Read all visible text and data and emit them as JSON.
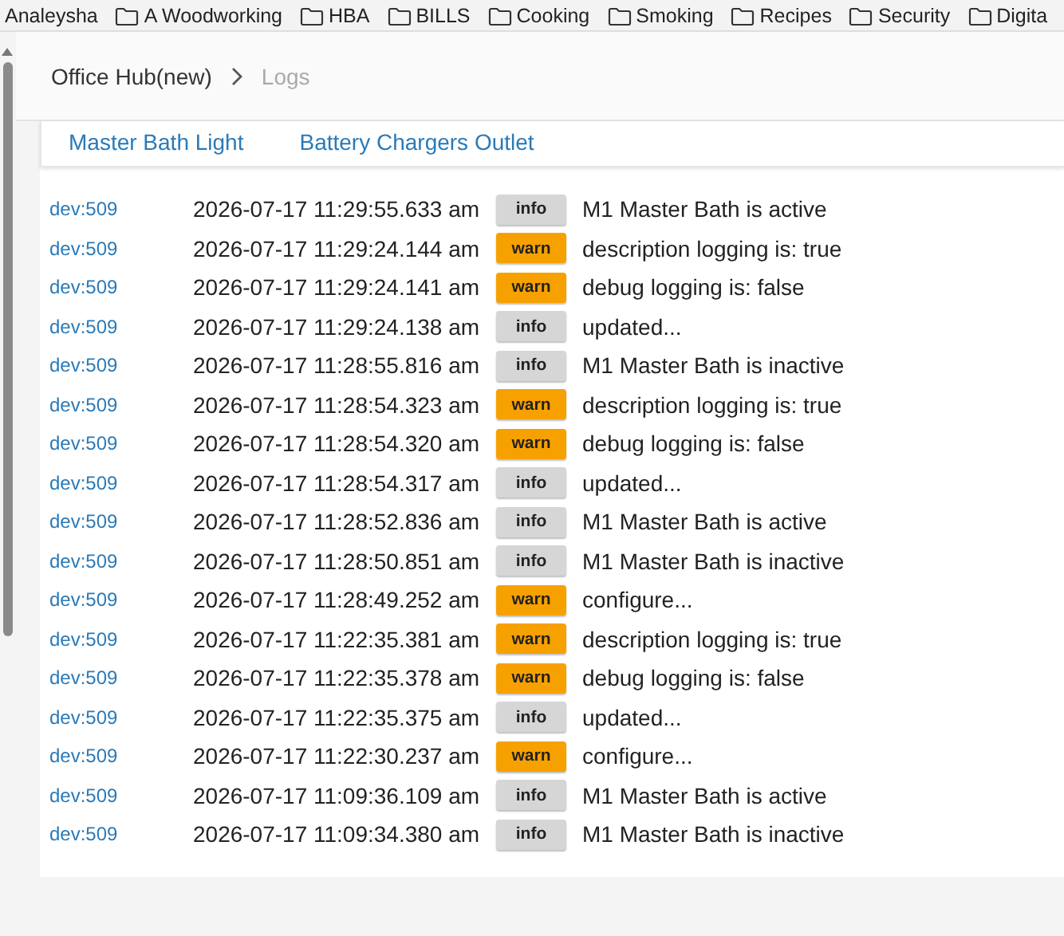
{
  "bookmarks": [
    {
      "label": "Analeysha",
      "kind": "link"
    },
    {
      "label": "A Woodworking",
      "kind": "folder"
    },
    {
      "label": "HBA",
      "kind": "folder"
    },
    {
      "label": "BILLS",
      "kind": "folder"
    },
    {
      "label": "Cooking",
      "kind": "folder"
    },
    {
      "label": "Smoking",
      "kind": "folder"
    },
    {
      "label": "Recipes",
      "kind": "folder"
    },
    {
      "label": "Security",
      "kind": "folder"
    },
    {
      "label": "Digita",
      "kind": "folder"
    }
  ],
  "breadcrumb": {
    "parent": "Office Hub(new)",
    "current": "Logs"
  },
  "device_links": [
    "Master Bath Light",
    "Battery Chargers Outlet"
  ],
  "logs": [
    {
      "device": "dev:509",
      "time": "2026-07-17 11:29:55.633 am",
      "severity": "info",
      "message": "M1 Master Bath is active"
    },
    {
      "device": "dev:509",
      "time": "2026-07-17 11:29:24.144 am",
      "severity": "warn",
      "message": "description logging is: true"
    },
    {
      "device": "dev:509",
      "time": "2026-07-17 11:29:24.141 am",
      "severity": "warn",
      "message": "debug logging is: false"
    },
    {
      "device": "dev:509",
      "time": "2026-07-17 11:29:24.138 am",
      "severity": "info",
      "message": "updated..."
    },
    {
      "device": "dev:509",
      "time": "2026-07-17 11:28:55.816 am",
      "severity": "info",
      "message": "M1 Master Bath is inactive"
    },
    {
      "device": "dev:509",
      "time": "2026-07-17 11:28:54.323 am",
      "severity": "warn",
      "message": "description logging is: true"
    },
    {
      "device": "dev:509",
      "time": "2026-07-17 11:28:54.320 am",
      "severity": "warn",
      "message": "debug logging is: false"
    },
    {
      "device": "dev:509",
      "time": "2026-07-17 11:28:54.317 am",
      "severity": "info",
      "message": "updated..."
    },
    {
      "device": "dev:509",
      "time": "2026-07-17 11:28:52.836 am",
      "severity": "info",
      "message": "M1 Master Bath is active"
    },
    {
      "device": "dev:509",
      "time": "2026-07-17 11:28:50.851 am",
      "severity": "info",
      "message": "M1 Master Bath is inactive"
    },
    {
      "device": "dev:509",
      "time": "2026-07-17 11:28:49.252 am",
      "severity": "warn",
      "message": "configure..."
    },
    {
      "device": "dev:509",
      "time": "2026-07-17 11:22:35.381 am",
      "severity": "warn",
      "message": "description logging is: true"
    },
    {
      "device": "dev:509",
      "time": "2026-07-17 11:22:35.378 am",
      "severity": "warn",
      "message": "debug logging is: false"
    },
    {
      "device": "dev:509",
      "time": "2026-07-17 11:22:35.375 am",
      "severity": "info",
      "message": "updated..."
    },
    {
      "device": "dev:509",
      "time": "2026-07-17 11:22:30.237 am",
      "severity": "warn",
      "message": "configure..."
    },
    {
      "device": "dev:509",
      "time": "2026-07-17 11:09:36.109 am",
      "severity": "info",
      "message": "M1 Master Bath is active"
    },
    {
      "device": "dev:509",
      "time": "2026-07-17 11:09:34.380 am",
      "severity": "info",
      "message": "M1 Master Bath is inactive"
    }
  ]
}
